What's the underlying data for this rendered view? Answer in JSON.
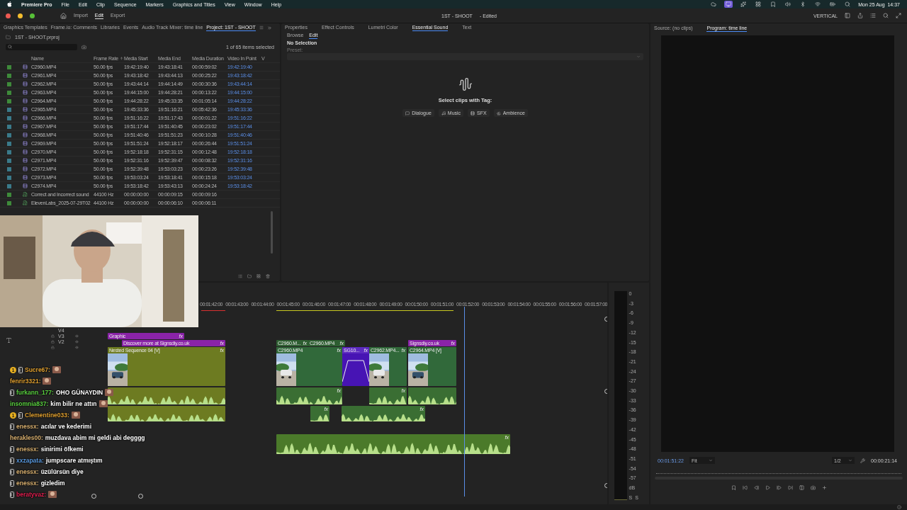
{
  "menu_bar": {
    "app": "Premiere Pro",
    "menus": [
      "File",
      "Edit",
      "Clip",
      "Sequence",
      "Markers",
      "Graphics and Titles",
      "View",
      "Window",
      "Help"
    ],
    "clock": "Mon 25 Aug  14:37"
  },
  "title_bar": {
    "workspaces": [
      {
        "label": "Import",
        "selected": false
      },
      {
        "label": "Edit",
        "selected": true
      },
      {
        "label": "Export",
        "selected": false
      }
    ],
    "title": "1ST - SHOOT",
    "status": "- Edited",
    "layout": "VERTICAL"
  },
  "project_panel": {
    "tabs": [
      {
        "label": "Graphics Templates",
        "selected": false
      },
      {
        "label": "Frame.io: Comments",
        "selected": false
      },
      {
        "label": "Libraries",
        "selected": false
      },
      {
        "label": "Events",
        "selected": false
      },
      {
        "label": "Audio Track Mixer: time line",
        "selected": false
      },
      {
        "label": "Project: 1ST - SHOOT",
        "selected": true
      }
    ],
    "file": "1ST - SHOOT.prproj",
    "selection_count": "1 of 65 items selected",
    "columns": [
      "Name",
      "Frame Rate",
      "Media Start",
      "Media End",
      "Media Duration",
      "Video In Point",
      "V"
    ],
    "rows": [
      {
        "color": "#3e8a3a",
        "kind": "video",
        "name": "C2960.MP4",
        "frame_rate": "50.00 fps",
        "media_start": "19:42:19:40",
        "media_end": "19:43:18:41",
        "duration": "00:00:59:02",
        "in_point": "19:42:19:40"
      },
      {
        "color": "#3e8a3a",
        "kind": "video",
        "name": "C2961.MP4",
        "frame_rate": "50.00 fps",
        "media_start": "19:43:18:42",
        "media_end": "19:43:44:13",
        "duration": "00:00:25:22",
        "in_point": "19:43:18:42"
      },
      {
        "color": "#3e8a3a",
        "kind": "video",
        "name": "C2962.MP4",
        "frame_rate": "50.00 fps",
        "media_start": "19:43:44:14",
        "media_end": "19:44:14:49",
        "duration": "00:00:30:36",
        "in_point": "19:43:44:14"
      },
      {
        "color": "#3e8a3a",
        "kind": "video",
        "name": "C2963.MP4",
        "frame_rate": "50.00 fps",
        "media_start": "19:44:15:00",
        "media_end": "19:44:28:21",
        "duration": "00:00:13:22",
        "in_point": "19:44:15:00"
      },
      {
        "color": "#3e8a3a",
        "kind": "video",
        "name": "C2964.MP4",
        "frame_rate": "50.00 fps",
        "media_start": "19:44:28:22",
        "media_end": "19:45:33:35",
        "duration": "00:01:05:14",
        "in_point": "19:44:28:22"
      },
      {
        "color": "#3a7a8a",
        "kind": "video",
        "name": "C2965.MP4",
        "frame_rate": "50.00 fps",
        "media_start": "19:45:33:36",
        "media_end": "19:51:16:21",
        "duration": "00:05:42:36",
        "in_point": "19:45:33:36"
      },
      {
        "color": "#3a7a8a",
        "kind": "video",
        "name": "C2966.MP4",
        "frame_rate": "50.00 fps",
        "media_start": "19:51:16:22",
        "media_end": "19:51:17:43",
        "duration": "00:00:01:22",
        "in_point": "19:51:16:22"
      },
      {
        "color": "#3a7a8a",
        "kind": "video",
        "name": "C2967.MP4",
        "frame_rate": "50.00 fps",
        "media_start": "19:51:17:44",
        "media_end": "19:51:40:45",
        "duration": "00:00:23:02",
        "in_point": "19:51:17:44"
      },
      {
        "color": "#3a7a8a",
        "kind": "video",
        "name": "C2968.MP4",
        "frame_rate": "50.00 fps",
        "media_start": "19:51:40:46",
        "media_end": "19:51:51:23",
        "duration": "00:00:10:28",
        "in_point": "19:51:40:46"
      },
      {
        "color": "#3a7a8a",
        "kind": "video",
        "name": "C2969.MP4",
        "frame_rate": "50.00 fps",
        "media_start": "19:51:51:24",
        "media_end": "19:52:18:17",
        "duration": "00:00:26:44",
        "in_point": "19:51:51:24"
      },
      {
        "color": "#3a7a8a",
        "kind": "video",
        "name": "C2970.MP4",
        "frame_rate": "50.00 fps",
        "media_start": "19:52:18:18",
        "media_end": "19:52:31:15",
        "duration": "00:00:12:48",
        "in_point": "19:52:18:18"
      },
      {
        "color": "#3a7a8a",
        "kind": "video",
        "name": "C2971.MP4",
        "frame_rate": "50.00 fps",
        "media_start": "19:52:31:16",
        "media_end": "19:52:39:47",
        "duration": "00:00:08:32",
        "in_point": "19:52:31:16"
      },
      {
        "color": "#3a7a8a",
        "kind": "video",
        "name": "C2972.MP4",
        "frame_rate": "50.00 fps",
        "media_start": "19:52:39:48",
        "media_end": "19:53:03:23",
        "duration": "00:00:23:26",
        "in_point": "19:52:39:48"
      },
      {
        "color": "#3a7a8a",
        "kind": "video",
        "name": "C2973.MP4",
        "frame_rate": "50.00 fps",
        "media_start": "19:53:03:24",
        "media_end": "19:53:18:41",
        "duration": "00:00:15:18",
        "in_point": "19:53:03:24"
      },
      {
        "color": "#3a7a8a",
        "kind": "video",
        "name": "C2974.MP4",
        "frame_rate": "50.00 fps",
        "media_start": "19:53:18:42",
        "media_end": "19:53:43:13",
        "duration": "00:00:24:24",
        "in_point": "19:53:18:42"
      },
      {
        "color": "#3e8a3a",
        "kind": "audio",
        "name": "Correct and Incorrect sound",
        "frame_rate": "44100 Hz",
        "media_start": "00:00:00:00",
        "media_end": "00:00:09:15",
        "duration": "00:00:09:16"
      },
      {
        "color": "#3e8a3a",
        "kind": "audio",
        "name": "ElevenLabs_2025-07-29T02",
        "frame_rate": "44100 Hz",
        "media_start": "00:00:00:00",
        "media_end": "00:00:06:10",
        "duration": "00:00:06:11"
      }
    ]
  },
  "essential_sound": {
    "tabs": [
      {
        "label": "Properties",
        "selected": false
      },
      {
        "label": "Effect Controls",
        "selected": false
      },
      {
        "label": "Lumetri Color",
        "selected": false
      },
      {
        "label": "Essential Sound",
        "selected": true
      },
      {
        "label": "Text",
        "selected": false
      }
    ],
    "subtabs": [
      {
        "label": "Browse",
        "selected": false
      },
      {
        "label": "Edit",
        "selected": true
      }
    ],
    "heading": "No Selection",
    "preset_label": "Preset:",
    "prompt": "Select clips with Tag:",
    "tags": [
      {
        "label": "Dialogue",
        "kind": "dialogue"
      },
      {
        "label": "Music",
        "kind": "music"
      },
      {
        "label": "SFX",
        "kind": "sfx"
      },
      {
        "label": "Ambience",
        "kind": "ambience"
      }
    ]
  },
  "program_monitor": {
    "tabs": [
      {
        "label": "Source: (no clips)",
        "selected": false
      },
      {
        "label": "Program: time line",
        "selected": true
      }
    ],
    "timecode": "00:01:51:22",
    "zoom": "Fit",
    "resolution": "1/2",
    "duration": "00:00:21:14"
  },
  "timeline": {
    "ruler": [
      "00:01:42:00",
      "00:01:43:00",
      "00:01:44:00",
      "00:01:45:00",
      "00:01:46:00",
      "00:01:47:00",
      "00:01:48:00",
      "00:01:49:00",
      "00:01:50:00",
      "00:01:51:00",
      "00:01:52:00",
      "00:01:53:00",
      "00:01:54:00",
      "00:01:55:00",
      "00:01:56:00",
      "00:01:57:00"
    ],
    "tracks": [
      {
        "name": "V4"
      },
      {
        "name": "V3",
        "clips": [
          {
            "label": "Graphic",
            "kind": "graphic",
            "badge": "fx"
          }
        ]
      },
      {
        "name": "V2",
        "clips": [
          {
            "label": "Discover more at Signsdiy.co.uk",
            "kind": "graphic",
            "badge": "fx"
          },
          {
            "label": "C2960.M...",
            "kind": "title",
            "badge": "fx"
          },
          {
            "label": "C2960.MP4",
            "kind": "title",
            "badge": "fx"
          },
          {
            "label": "Signsdiy.co.uk",
            "kind": "graphic",
            "badge": "fx"
          }
        ]
      },
      {
        "clips": [
          {
            "label": "Nested Sequence 04 [V]",
            "kind": "nested",
            "badge": "fx"
          },
          {
            "label": "C2960.MP4",
            "kind": "video",
            "badge": "fx"
          },
          {
            "label": "SG10...",
            "kind": "keyframed",
            "badge": "fx"
          },
          {
            "label": "C2962.MP4...",
            "kind": "video",
            "badge": "fx"
          },
          {
            "label": "C2964.MP4 [V]",
            "kind": "video"
          }
        ]
      },
      {
        "clips": [
          {
            "kind": "nested_audio"
          },
          {
            "kind": "audio",
            "badge": "fx"
          },
          {
            "kind": "audio",
            "badge": "fx"
          },
          {
            "kind": "audio"
          }
        ]
      },
      {
        "clips": [
          {
            "kind": "nested_audio"
          },
          {
            "kind": "audio",
            "badge": "fx"
          },
          {
            "kind": "audio",
            "badge": "fx"
          }
        ]
      },
      {
        "clips": [
          {
            "kind": "music",
            "badge": "fx"
          }
        ]
      }
    ]
  },
  "meter": {
    "scale": [
      "0",
      "-3",
      "-6",
      "-9",
      "-12",
      "-15",
      "-18",
      "-21",
      "-24",
      "-27",
      "-30",
      "-33",
      "-36",
      "-39",
      "-42",
      "-45",
      "-48",
      "-51",
      "-54",
      "-57",
      "dB"
    ],
    "solo": [
      "S",
      "S"
    ]
  },
  "chat": [
    {
      "sub_badge": "1",
      "badge": true,
      "user": "Sucre67:",
      "color": "#e0a030",
      "emote": true
    },
    {
      "badge": false,
      "user": "fenrir3321:",
      "color": "#e0a030",
      "emote": true
    },
    {
      "badge": true,
      "user": "furkann_177:",
      "color": "#5ad040",
      "message": "OHO GÜNAYDIN",
      "emote": true
    },
    {
      "badge": false,
      "user": "insomnia837:",
      "color": "#5ad040",
      "message": "kim bilir ne attın",
      "emote": true
    },
    {
      "sub_badge": "1",
      "badge": true,
      "user": "Clementine033:",
      "color": "#e0a030",
      "emote": true
    },
    {
      "badge": true,
      "user": "enessx:",
      "color": "#d8b070",
      "message": "acılar ve kederimi",
      "emote": false
    },
    {
      "badge": false,
      "user": "herakles00:",
      "color": "#d8b070",
      "message": "muzdava abim mi geldi abi degggg",
      "emote": false
    },
    {
      "badge": true,
      "user": "enessx:",
      "color": "#d8b070",
      "message": "sinirimi öfkemi",
      "emote": false
    },
    {
      "badge": true,
      "user": "xxzapata:",
      "color": "#5a9ae0",
      "message": "jumpscare atmıştım",
      "emote": false
    },
    {
      "badge": true,
      "user": "enessx:",
      "color": "#d8b070",
      "message": "üzülürsün diye",
      "emote": false
    },
    {
      "badge": true,
      "user": "enessx:",
      "color": "#d8b070",
      "message": "gizledim",
      "emote": false
    },
    {
      "badge": true,
      "user": "beratyvaz:",
      "color": "#e02050",
      "emote": true
    }
  ]
}
